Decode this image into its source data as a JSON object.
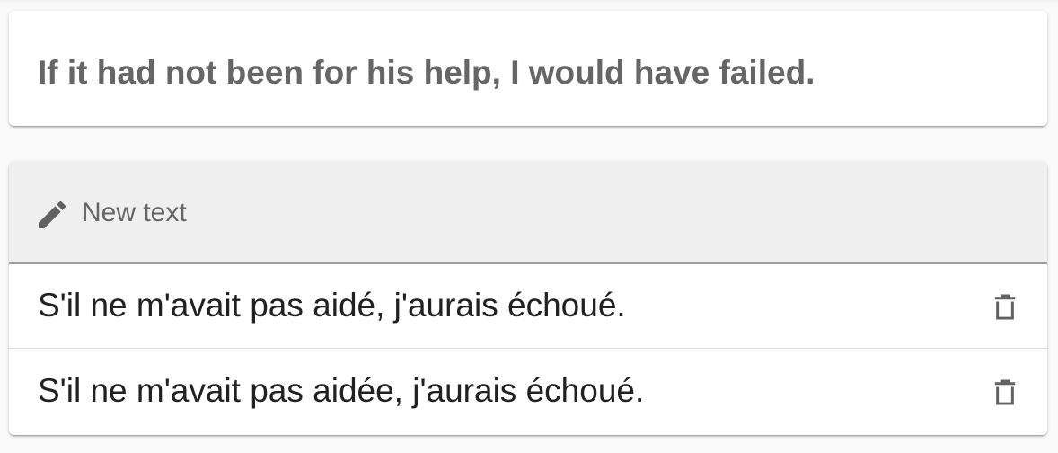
{
  "source": {
    "text": "If it had not been for his help, I would have failed."
  },
  "new_text": {
    "label": "New text",
    "icon": "pencil-icon"
  },
  "translations": [
    {
      "text": "S'il ne m'avait pas aidé, j'aurais échoué.",
      "icon": "trash-icon"
    },
    {
      "text": "S'il ne m'avait pas aidée, j'aurais échoué.",
      "icon": "trash-icon"
    }
  ],
  "colors": {
    "background": "#fafafa",
    "card": "#ffffff",
    "header_bg": "#efefef",
    "muted_text": "#666666",
    "body_text": "#212121",
    "icon": "#616161"
  }
}
